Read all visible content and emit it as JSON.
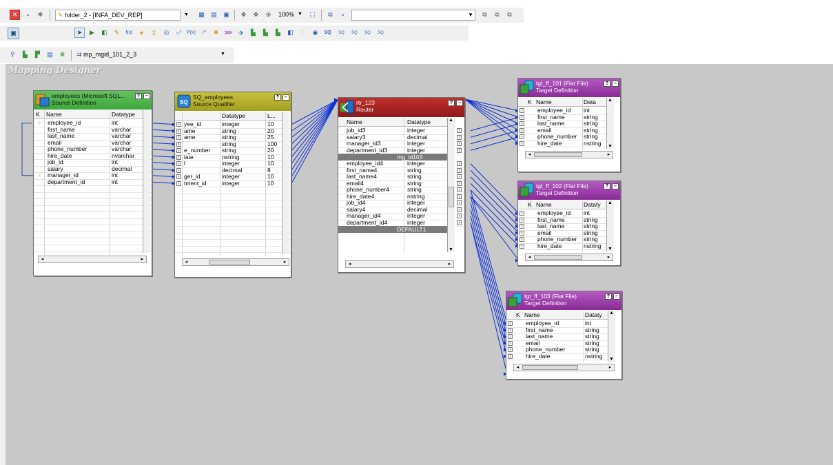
{
  "toolbar1": {
    "folder": "folder_2 - [INFA_DEV_REP]",
    "zoom": "100%"
  },
  "toolbar3": {
    "mapping": "mp_mgid_101_2_3"
  },
  "designer_title": "Mapping Designer",
  "colors": {
    "source_header": "#49b24a",
    "sq_header": "#b2ac2a",
    "router_header": "#a51e22",
    "target_header": "#9a3aa2",
    "link": "#0b2fd6"
  },
  "source": {
    "name": "employees (Microsoft SQL...",
    "subtitle": "Source Definition",
    "columns": [
      "K",
      "Name",
      "Datatype"
    ],
    "rows": [
      {
        "key": true,
        "name": "employee_id",
        "type": "int"
      },
      {
        "key": false,
        "name": "first_name",
        "type": "varchar"
      },
      {
        "key": false,
        "name": "last_name",
        "type": "varchar"
      },
      {
        "key": false,
        "name": "email",
        "type": "varchar"
      },
      {
        "key": false,
        "name": "phone_number",
        "type": "varchar"
      },
      {
        "key": false,
        "name": "hire_date",
        "type": "nvarchar"
      },
      {
        "key": false,
        "name": "job_id",
        "type": "int"
      },
      {
        "key": false,
        "name": "salary",
        "type": "decimal"
      },
      {
        "key": true,
        "name": "manager_id",
        "type": "int"
      },
      {
        "key": false,
        "name": "department_id",
        "type": "int"
      }
    ]
  },
  "sq": {
    "name": "SQ_employees",
    "subtitle": "Source Qualifier",
    "columns": [
      "",
      "Datatype",
      "L..."
    ],
    "rows": [
      {
        "name": "yee_id",
        "type": "integer",
        "len": "10"
      },
      {
        "name": "ame",
        "type": "string",
        "len": "20"
      },
      {
        "name": "ame",
        "type": "string",
        "len": "25"
      },
      {
        "name": "",
        "type": "string",
        "len": "100"
      },
      {
        "name": "e_number",
        "type": "string",
        "len": "20"
      },
      {
        "name": "late",
        "type": "nstring",
        "len": "10"
      },
      {
        "name": "l",
        "type": "integer",
        "len": "10"
      },
      {
        "name": "",
        "type": "decimal",
        "len": "8"
      },
      {
        "name": "ger_id",
        "type": "integer",
        "len": "10"
      },
      {
        "name": "tment_id",
        "type": "integer",
        "len": "10"
      }
    ]
  },
  "router": {
    "name": "rtr_123",
    "subtitle": "Router",
    "columns": [
      "Name",
      "Datatype"
    ],
    "rows_a": [
      {
        "name": "job_id3",
        "type": "integer"
      },
      {
        "name": "salary3",
        "type": "decimal"
      },
      {
        "name": "manager_id3",
        "type": "integer"
      },
      {
        "name": "department_id3",
        "type": "integer"
      }
    ],
    "group": "mg_id103",
    "rows_b": [
      {
        "name": "employee_id4",
        "type": "integer"
      },
      {
        "name": "first_name4",
        "type": "string"
      },
      {
        "name": "last_name4",
        "type": "string"
      },
      {
        "name": "email4",
        "type": "string"
      },
      {
        "name": "phone_number4",
        "type": "string"
      },
      {
        "name": "hire_date4",
        "type": "nstring"
      },
      {
        "name": "job_id4",
        "type": "integer"
      },
      {
        "name": "salary4",
        "type": "decimal"
      },
      {
        "name": "manager_id4",
        "type": "integer"
      },
      {
        "name": "department_id4",
        "type": "integer"
      }
    ],
    "default_group": "DEFAULT1"
  },
  "targets": [
    {
      "name": "tgt_ff_101 (Flat File)",
      "subtitle": "Target Definition",
      "columns": [
        "K",
        "Name",
        "Data"
      ],
      "rows": [
        {
          "name": "employee_id",
          "type": "int"
        },
        {
          "name": "first_name",
          "type": "string"
        },
        {
          "name": "last_name",
          "type": "string"
        },
        {
          "name": "email",
          "type": "string"
        },
        {
          "name": "phone_number",
          "type": "string"
        },
        {
          "name": "hire_date",
          "type": "nstring"
        }
      ]
    },
    {
      "name": "tgt_ff_102 (Flat File)",
      "subtitle": "Target Definition",
      "columns": [
        "K",
        "Name",
        "Dataty"
      ],
      "rows": [
        {
          "name": "employee_id",
          "type": "int"
        },
        {
          "name": "first_name",
          "type": "string"
        },
        {
          "name": "last_name",
          "type": "string"
        },
        {
          "name": "email",
          "type": "string"
        },
        {
          "name": "phone_number",
          "type": "string"
        },
        {
          "name": "hire_date",
          "type": "nstring"
        }
      ]
    },
    {
      "name": "tgt_ff_103 (Flat File)",
      "subtitle": "Target Definition",
      "columns": [
        "K",
        "Name",
        "Dataty"
      ],
      "rows": [
        {
          "name": "employee_id",
          "type": "int"
        },
        {
          "name": "first_name",
          "type": "string"
        },
        {
          "name": "last_name",
          "type": "string"
        },
        {
          "name": "email",
          "type": "string"
        },
        {
          "name": "phone_number",
          "type": "string"
        },
        {
          "name": "hire_date",
          "type": "nstring"
        }
      ]
    }
  ]
}
